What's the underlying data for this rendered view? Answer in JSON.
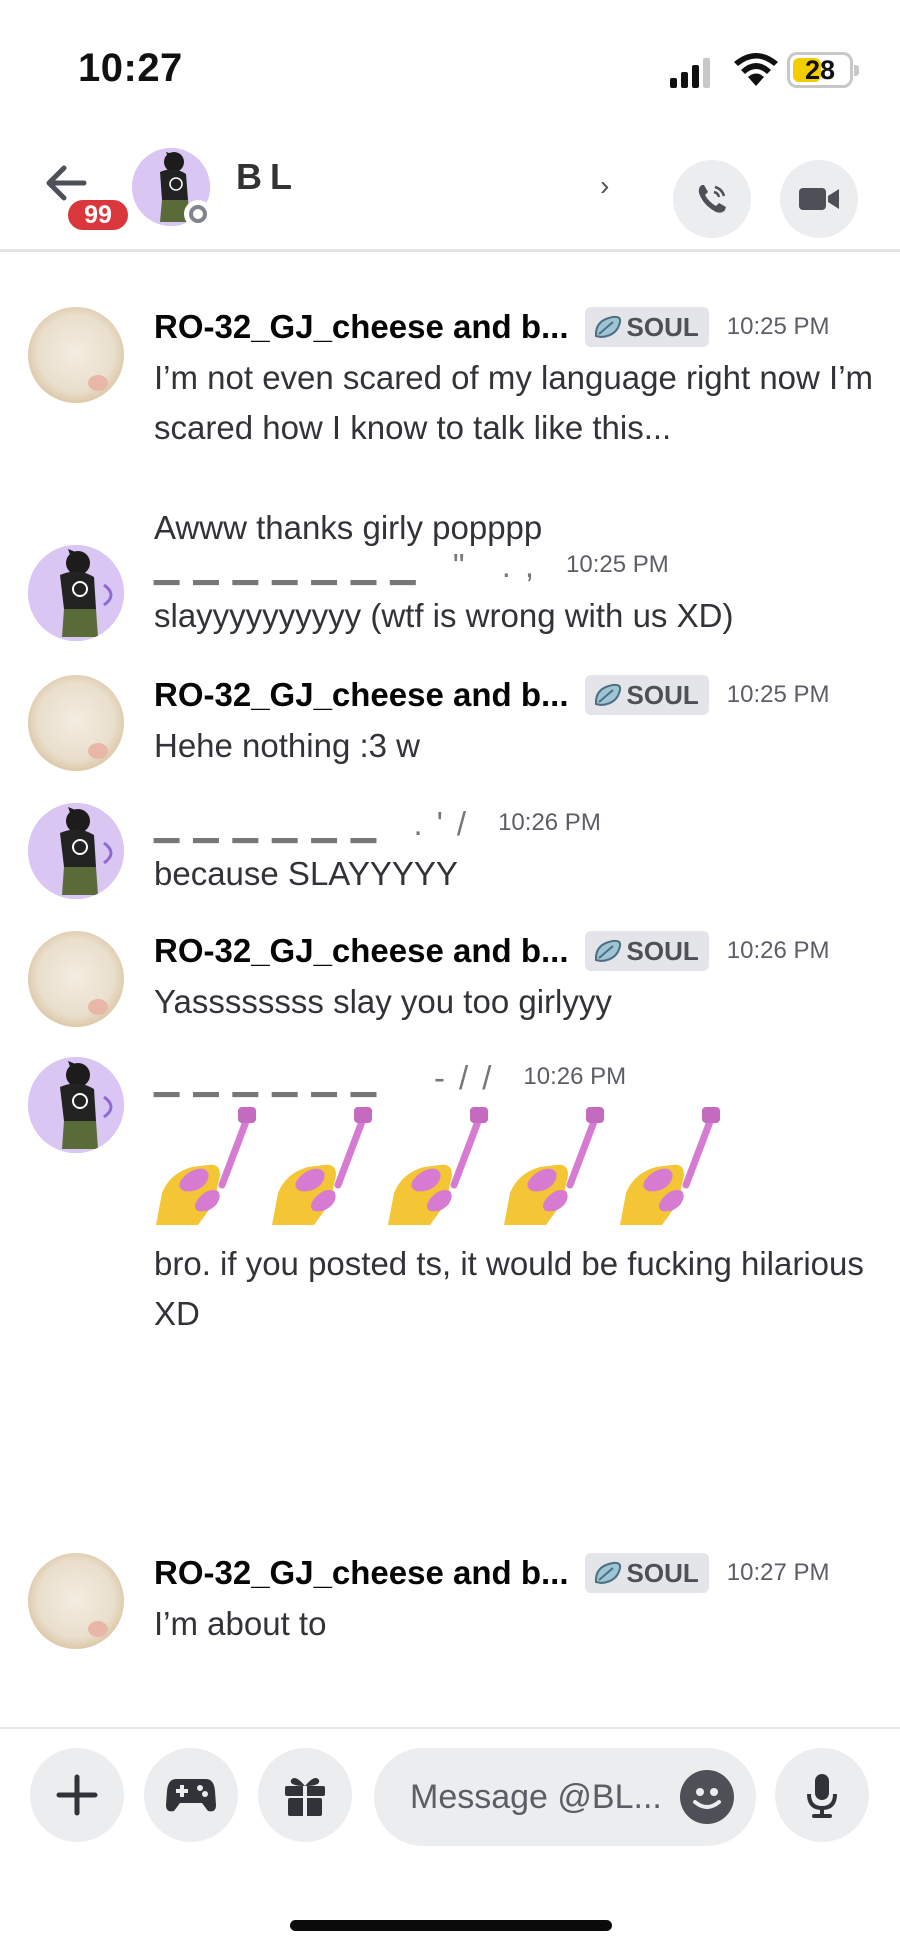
{
  "status_bar": {
    "time": "10:27",
    "battery": "28"
  },
  "header": {
    "unread_count": "99",
    "name": "BL                        ",
    "chevron": "›"
  },
  "messages": [
    {
      "user": "RO-32_GJ_cheese and b...",
      "tag": "SOUL",
      "time": "10:25 PM",
      "lines": [
        "I’m not even scared of my language right now I’m scared how I know to talk like this..."
      ],
      "extra": "Awww thanks girly popppp"
    },
    {
      "user": "▁▁▁▁▁▁▁ \" .,",
      "time": "10:25 PM",
      "lines": [
        "slayyyyyyyyyy (wtf is wrong with us XD)"
      ]
    },
    {
      "user": "RO-32_GJ_cheese and b...",
      "tag": "SOUL",
      "time": "10:25 PM",
      "lines": [
        "Hehe nothing :3 w"
      ]
    },
    {
      "user": "▁▁▁▁▁▁ .'/",
      "time": "10:26 PM",
      "lines": [
        "because SLAYYYYY"
      ]
    },
    {
      "user": "RO-32_GJ_cheese and b...",
      "tag": "SOUL",
      "time": "10:26 PM",
      "lines": [
        "Yassssssss slay you too girlyyy"
      ]
    },
    {
      "user": "▁▁▁▁▁▁  -//",
      "time": "10:26 PM",
      "emoji_name": "nail-polish-icon",
      "lines": [
        "bro. if you posted ts, it would be fucking hilarious XD"
      ]
    },
    {
      "user": "RO-32_GJ_cheese and b...",
      "tag": "SOUL",
      "time": "10:27 PM",
      "lines": [
        "I’m about to"
      ]
    }
  ],
  "composer": {
    "placeholder": "Message @BL..."
  },
  "colors": {
    "badge_red": "#da373c",
    "tag_bg": "#e3e5e8",
    "battery_yellow": "#f2cd00",
    "avatar_purple": "#d9c6f3"
  }
}
